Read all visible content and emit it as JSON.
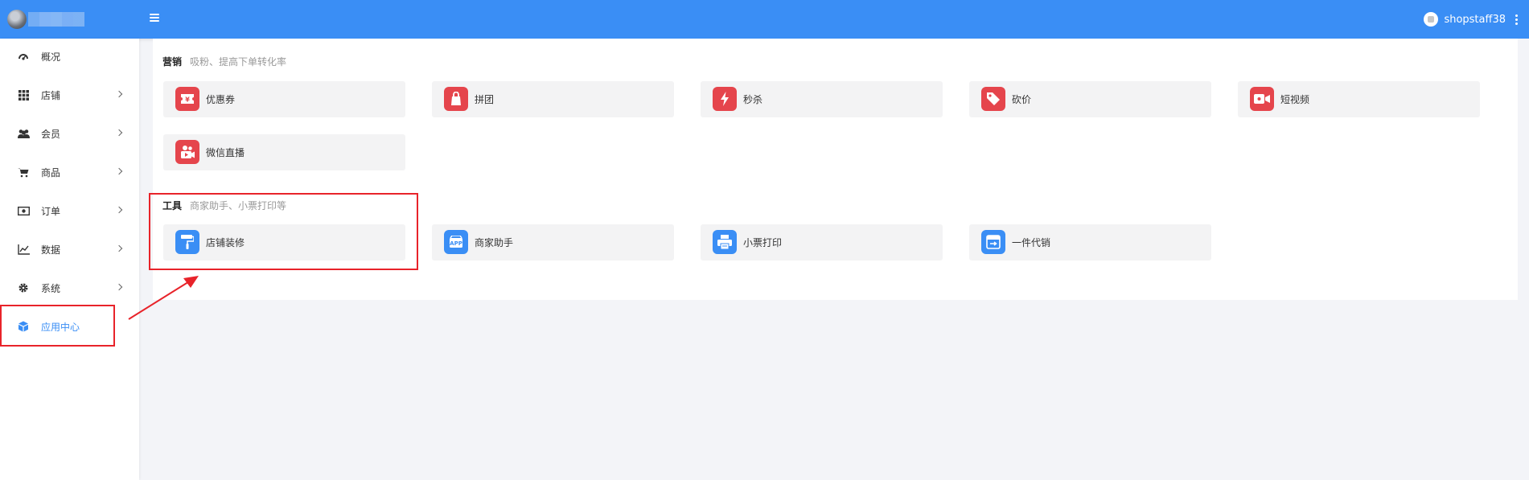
{
  "header": {
    "menu_icon": "hamburger-icon",
    "user_name": "shopstaff38",
    "more_icon": "vertical-dots-icon",
    "color": "#3a8ef5"
  },
  "sidebar": {
    "items": [
      {
        "label": "概况",
        "icon": "dashboard-icon",
        "has_arrow": false
      },
      {
        "label": "店铺",
        "icon": "grid-icon",
        "has_arrow": true
      },
      {
        "label": "会员",
        "icon": "users-icon",
        "has_arrow": true
      },
      {
        "label": "商品",
        "icon": "cart-icon",
        "has_arrow": true
      },
      {
        "label": "订单",
        "icon": "money-icon",
        "has_arrow": true
      },
      {
        "label": "数据",
        "icon": "chart-icon",
        "has_arrow": true
      },
      {
        "label": "系统",
        "icon": "gear-icon",
        "has_arrow": true
      },
      {
        "label": "应用中心",
        "icon": "cube-icon",
        "has_arrow": false,
        "active": true
      }
    ]
  },
  "sections": {
    "marketing": {
      "title": "营销",
      "desc": "吸粉、提高下单转化率",
      "items": [
        {
          "label": "优惠券",
          "icon": "coupon-icon",
          "color": "#e5454c"
        },
        {
          "label": "拼团",
          "icon": "group-bag-icon",
          "color": "#e5454c"
        },
        {
          "label": "秒杀",
          "icon": "flash-icon",
          "color": "#e5454c"
        },
        {
          "label": "砍价",
          "icon": "price-tag-icon",
          "color": "#e5454c"
        },
        {
          "label": "短视频",
          "icon": "video-icon",
          "color": "#e5454c"
        },
        {
          "label": "微信直播",
          "icon": "live-camera-icon",
          "color": "#e5454c"
        }
      ]
    },
    "tools": {
      "title": "工具",
      "desc": "商家助手、小票打印等",
      "items": [
        {
          "label": "店铺装修",
          "icon": "paint-roller-icon",
          "color": "#3a8ef5"
        },
        {
          "label": "商家助手",
          "icon": "app-assistant-icon",
          "color": "#3a8ef5"
        },
        {
          "label": "小票打印",
          "icon": "printer-icon",
          "color": "#3a8ef5"
        },
        {
          "label": "一件代销",
          "icon": "dropship-icon",
          "color": "#3a8ef5"
        }
      ]
    }
  },
  "annotations": {
    "highlight_color": "#e8232a"
  }
}
